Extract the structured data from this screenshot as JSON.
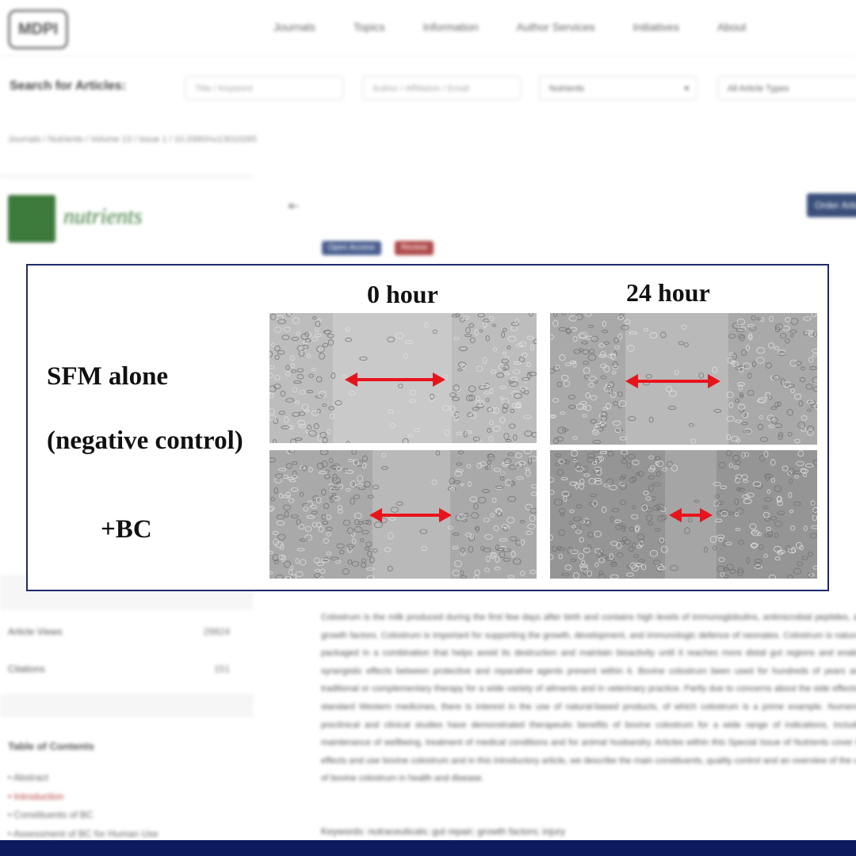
{
  "site": {
    "logo_text": "MDPI",
    "nav": [
      "Journals",
      "Topics",
      "Information",
      "Author Services",
      "Initiatives",
      "About"
    ]
  },
  "search": {
    "label": "Search for Articles:",
    "title_placeholder": "Title / Keyword",
    "author_placeholder": "Author / Affiliation / Email",
    "journal_value": "Nutrients",
    "type_value": "All Article Types"
  },
  "breadcrumb": "Journals / Nutrients / Volume 13 / Issue 1 / 10.3390/nu13010265",
  "journal": {
    "name": "nutrients"
  },
  "badges": {
    "open_access": "Open Access",
    "review": "Review"
  },
  "order_button": "Order Article",
  "stats": [
    {
      "label": "Article Views",
      "value": "29824"
    },
    {
      "label": "Citations",
      "value": "151"
    }
  ],
  "toc": {
    "title": "Table of Contents",
    "items": [
      "Abstract",
      "Introduction",
      "Constituents of BC",
      "Assessment of BC for Human Use"
    ]
  },
  "abstract_text": "Colostrum is the milk produced during the first few days after birth and contains high levels of immunoglobulins, antimicrobial peptides, and growth factors. Colostrum is important for supporting the growth, development, and immunologic defence of neonates. Colostrum is naturally packaged in a combination that helps avoid its destruction and maintain bioactivity until it reaches more distal gut regions and enables synergistic effects between protective and reparative agents present within it. Bovine colostrum been used for hundreds of years as a traditional or complementary therapy for a wide variety of ailments and in veterinary practice. Partly due to concerns about the side effects of standard Western medicines, there is interest in the use of natural-based products, of which colostrum is a prime example. Numerous preclinical and clinical studies have demonstrated therapeutic benefits of bovine colostrum for a wide range of indications, including maintenance of wellbeing, treatment of medical conditions and for animal husbandry. Articles within this Special Issue of Nutrients cover the effects and use bovine colostrum and in this introductory article, we describe the main constituents, quality control and an overview of the use of bovine colostrum in health and disease.",
  "keywords": "Keywords: nutraceuticals; gut repair; growth factors; injury",
  "figure": {
    "col_headers": [
      "0 hour",
      "24 hour"
    ],
    "row_label_1a": "SFM alone",
    "row_label_1b": "(negative control)",
    "row_label_2": "+BC",
    "arrow_color": "#e8141c",
    "border_color": "#1d2a6e"
  }
}
